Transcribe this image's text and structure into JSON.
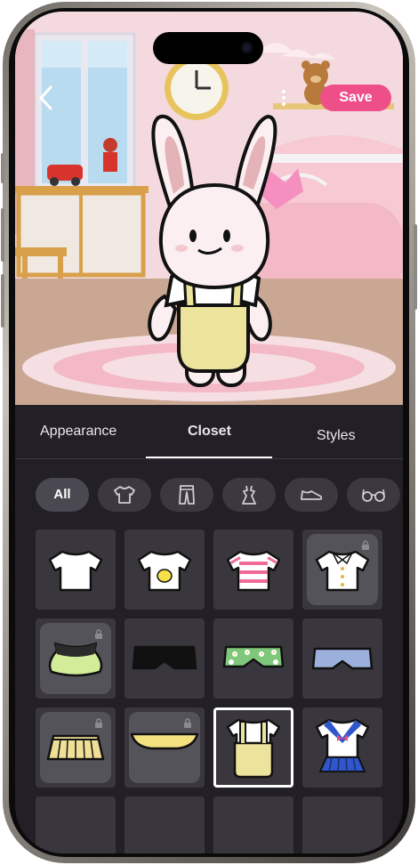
{
  "header": {
    "save_label": "Save"
  },
  "tabs": [
    {
      "label": "Appearance",
      "active": false
    },
    {
      "label": "Closet",
      "active": true
    },
    {
      "label": "Styles",
      "active": false
    }
  ],
  "filters": [
    {
      "label": "All",
      "icon": "all",
      "active": true
    },
    {
      "label": "",
      "icon": "tshirt-icon",
      "active": false
    },
    {
      "label": "",
      "icon": "pants-icon",
      "active": false
    },
    {
      "label": "",
      "icon": "dress-icon",
      "active": false
    },
    {
      "label": "",
      "icon": "shoe-icon",
      "active": false
    },
    {
      "label": "",
      "icon": "glasses-icon",
      "active": false
    }
  ],
  "items": [
    {
      "name": "white-tshirt",
      "locked": false,
      "selected": false
    },
    {
      "name": "lemon-tshirt",
      "locked": false,
      "selected": false
    },
    {
      "name": "striped-pink-tshirt",
      "locked": false,
      "selected": false
    },
    {
      "name": "button-blouse",
      "locked": true,
      "selected": false
    },
    {
      "name": "lime-skirt",
      "locked": true,
      "selected": false
    },
    {
      "name": "black-shorts",
      "locked": false,
      "selected": false
    },
    {
      "name": "daisy-shorts",
      "locked": false,
      "selected": false
    },
    {
      "name": "blue-shorts",
      "locked": false,
      "selected": false
    },
    {
      "name": "yellow-pleated-skirt",
      "locked": true,
      "selected": false
    },
    {
      "name": "yellow-bloomers",
      "locked": true,
      "selected": false
    },
    {
      "name": "yellow-overalls",
      "locked": false,
      "selected": true
    },
    {
      "name": "sailor-uniform",
      "locked": false,
      "selected": false
    }
  ],
  "colors": {
    "accent": "#ef4f88",
    "panel": "#222026",
    "cell": "#39373d",
    "character_overalls": "#ece39c"
  }
}
